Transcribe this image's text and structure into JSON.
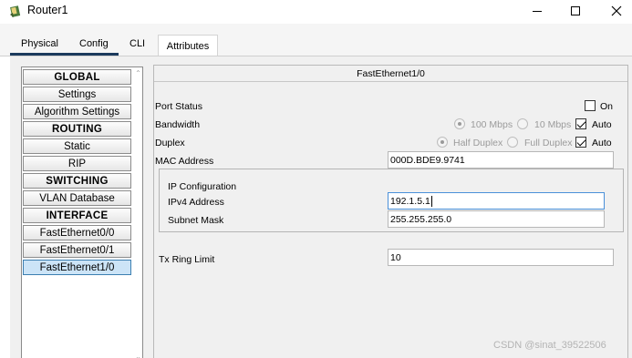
{
  "window": {
    "title": "Router1",
    "controls": {
      "minimize": "minimize-icon",
      "maximize": "maximize-icon",
      "close": "close-icon"
    }
  },
  "tabs": [
    {
      "label": "Physical"
    },
    {
      "label": "Config"
    },
    {
      "label": "CLI"
    },
    {
      "label": "Attributes"
    }
  ],
  "active_tab": "Config",
  "nav": {
    "items": [
      {
        "label": "GLOBAL",
        "header": true
      },
      {
        "label": "Settings"
      },
      {
        "label": "Algorithm Settings"
      },
      {
        "label": "ROUTING",
        "header": true
      },
      {
        "label": "Static"
      },
      {
        "label": "RIP"
      },
      {
        "label": "SWITCHING",
        "header": true
      },
      {
        "label": "VLAN Database"
      },
      {
        "label": "INTERFACE",
        "header": true
      },
      {
        "label": "FastEthernet0/0"
      },
      {
        "label": "FastEthernet0/1"
      },
      {
        "label": "FastEthernet1/0",
        "selected": true
      }
    ]
  },
  "panel": {
    "title": "FastEthernet1/0",
    "port_status": {
      "label": "Port Status",
      "on_label": "On",
      "on_checked": false
    },
    "bandwidth": {
      "label": "Bandwidth",
      "option_100": "100 Mbps",
      "option_10": "10 Mbps",
      "auto_label": "Auto",
      "auto_checked": true
    },
    "duplex": {
      "label": "Duplex",
      "option_half": "Half Duplex",
      "option_full": "Full Duplex",
      "auto_label": "Auto",
      "auto_checked": true
    },
    "mac": {
      "label": "MAC Address",
      "value": "000D.BDE9.9741"
    },
    "ip_config": {
      "title": "IP Configuration",
      "ipv4_label": "IPv4 Address",
      "ipv4_value": "192.1.5.1",
      "mask_label": "Subnet Mask",
      "mask_value": "255.255.255.0"
    },
    "tx_ring": {
      "label": "Tx Ring Limit",
      "value": "10"
    }
  },
  "watermark": "CSDN @sinat_39522506",
  "colors": {
    "tab_indicator": "#1b3a5c",
    "selection": "#cce4f7",
    "focus_border": "#4a90d9"
  }
}
